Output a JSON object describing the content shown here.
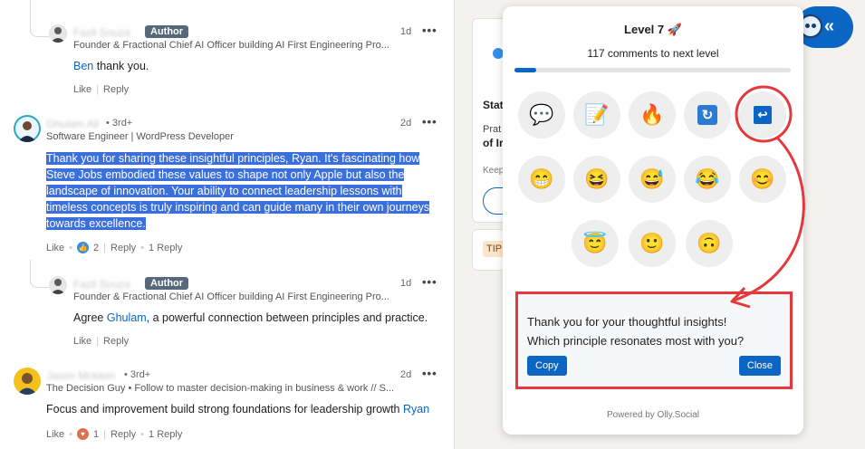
{
  "feed": {
    "c1": {
      "name": "Fazil Souza",
      "badge": "Author",
      "headline": "Founder & Fractional Chief AI Officer building AI First Engineering Pro...",
      "time": "1d",
      "mention": "Ben",
      "text": " thank you.",
      "like": "Like",
      "reply": "Reply"
    },
    "c2": {
      "name": "Ghulam Ali",
      "degree": "• 3rd+",
      "headline": "Software Engineer | WordPress Developer",
      "time": "2d",
      "lines": [
        "Thank you for sharing these insightful principles, Ryan. It's fascinating how",
        "Steve Jobs embodied these values to shape not only Apple but also the",
        "landscape of innovation. Your ability to connect leadership lessons with",
        "timeless concepts is truly inspiring and can guide many in their own journeys",
        "towards excellence."
      ],
      "like": "Like",
      "reaction_count": "2",
      "reply": "Reply",
      "replies": "1 Reply"
    },
    "c3": {
      "name": "Fazil Souza",
      "badge": "Author",
      "headline": "Founder & Fractional Chief AI Officer building AI First Engineering Pro...",
      "time": "1d",
      "prefix": "Agree ",
      "mention": "Ghulam",
      "text": ", a powerful connection between principles and practice.",
      "like": "Like",
      "reply": "Reply"
    },
    "c4": {
      "name": "Jason Mcklein",
      "degree": "• 3rd+",
      "headline": "The Decision Guy • Follow to master decision-making in business & work // S...",
      "time": "2d",
      "text": "Focus and improvement build strong foundations for leadership growth ",
      "mention": "Ryan",
      "like": "Like",
      "reaction_count": "1",
      "reply": "Reply",
      "replies": "1 Reply"
    }
  },
  "middle": {
    "t1": "Stat",
    "t2": "Prat",
    "t3": "of Ir",
    "t4": "Keep",
    "tip": "TIP"
  },
  "panel": {
    "level": "Level 7 🚀",
    "next_level": "117 comments to next level",
    "progress_fraction": 0.08,
    "icons_row1": [
      "💬",
      "📝",
      "🔥",
      "🔄",
      "↩"
    ],
    "icons_row1_names": [
      "speech-bubble-icon",
      "memo-icon",
      "fire-icon",
      "refresh-icon",
      "reply-icon"
    ],
    "emojis_row2": [
      "😁",
      "😆",
      "😅",
      "😂",
      "😊"
    ],
    "emojis_row3": [
      "😇",
      "🙂",
      "🙃"
    ],
    "message_line1": "Thank you for your thoughtful insights!",
    "message_line2": "Which principle resonates most with you?",
    "copy_label": "Copy",
    "close_label": "Close",
    "powered": "Powered by Olly.Social"
  },
  "colors": {
    "accent": "#0a66c2",
    "highlight": "#3a6fdc",
    "annotation_red": "#e5383b"
  }
}
